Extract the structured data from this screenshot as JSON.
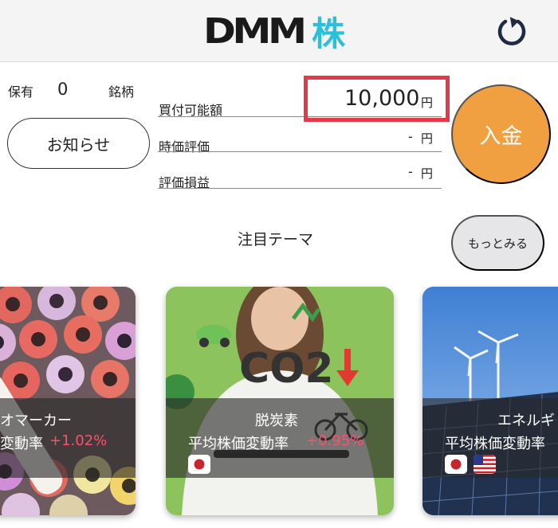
{
  "header": {
    "logo_text": "DMM",
    "logo_kabu": "株"
  },
  "summary": {
    "holding_label": "保有",
    "holding_count": "0",
    "holding_unit": "銘柄",
    "notice_button": "お知らせ",
    "rows": [
      {
        "label": "買付可能額",
        "value": "10,000",
        "unit": "円"
      },
      {
        "label": "時価評価",
        "value": "-",
        "unit": "円"
      },
      {
        "label": "評価損益",
        "value": "-",
        "unit": "円"
      }
    ],
    "deposit_button": "入金"
  },
  "themes": {
    "title": "注目テーマ",
    "more_button": "もっとみる",
    "cards": [
      {
        "name": "オマーカー",
        "rate_label": "変動率",
        "rate_value": "+1.02%",
        "flags": []
      },
      {
        "name": "脱炭素",
        "rate_label": "平均株価変動率",
        "rate_value": "+0.95%",
        "flags": [
          "jp"
        ]
      },
      {
        "name": "エネルギ",
        "rate_label": "平均株価変動率",
        "rate_value": "",
        "flags": [
          "jp",
          "us"
        ]
      }
    ],
    "card2_text": "CO2"
  },
  "colors": {
    "accent_red": "#e5394a",
    "deposit_orange": "#f0a040",
    "logo_cyan": "#2bc0d9",
    "positive_pink": "#ff4f6a"
  }
}
